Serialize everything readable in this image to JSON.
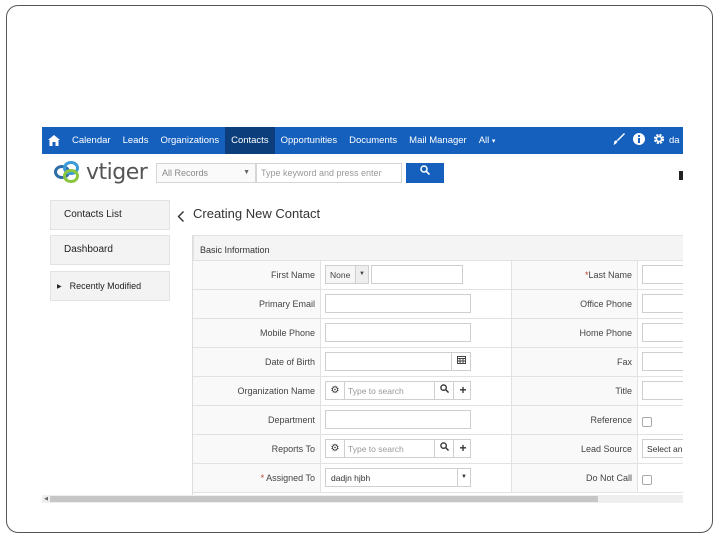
{
  "nav": {
    "items": [
      "Calendar",
      "Leads",
      "Organizations",
      "Contacts",
      "Opportunities",
      "Documents",
      "Mail Manager",
      "All"
    ],
    "all_caret": "▾",
    "user_abbrev": "da",
    "brand_color": "#1560bd",
    "active_color": "#0b3e7a"
  },
  "logo": {
    "text": "vtiger"
  },
  "search": {
    "records_select": "All Records",
    "placeholder": "Type keyword and press enter"
  },
  "sidebar": {
    "contacts_list": "Contacts List",
    "dashboard": "Dashboard",
    "recently_modified": "Recently Modified"
  },
  "page": {
    "title": "Creating New Contact",
    "block_title": "Basic Information"
  },
  "form": {
    "rows": [
      {
        "left_label": "First Name",
        "left_required": false,
        "right_label": "Last Name",
        "right_required": true
      },
      {
        "left_label": "Primary Email",
        "left_required": false,
        "right_label": "Office Phone",
        "right_required": false
      },
      {
        "left_label": "Mobile Phone",
        "left_required": false,
        "right_label": "Home Phone",
        "right_required": false
      },
      {
        "left_label": "Date of Birth",
        "left_required": false,
        "right_label": "Fax",
        "right_required": false
      },
      {
        "left_label": "Organization Name",
        "left_required": false,
        "right_label": "Title",
        "right_required": false
      },
      {
        "left_label": "Department",
        "left_required": false,
        "right_label": "Reference",
        "right_required": false
      },
      {
        "left_label": "Reports To",
        "left_required": false,
        "right_label": "Lead Source",
        "right_required": false
      },
      {
        "left_label": "Assigned To",
        "left_required": true,
        "right_label": "Do Not Call",
        "right_required": false
      }
    ],
    "salutation_value": "None",
    "org_placeholder": "Type to search",
    "reports_placeholder": "Type to search",
    "assigned_value": "dadjn hjbh",
    "lead_source_value": "Select an Option",
    "required_mark": "*"
  }
}
